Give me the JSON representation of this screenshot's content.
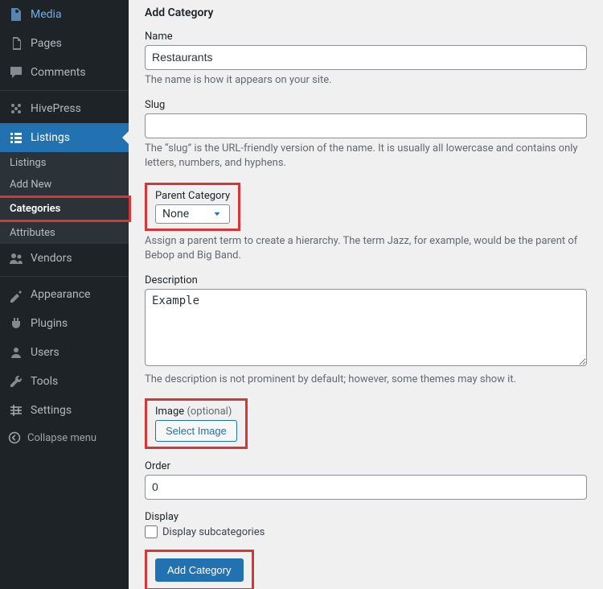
{
  "sidebar": {
    "items": [
      {
        "label": "Media"
      },
      {
        "label": "Pages"
      },
      {
        "label": "Comments"
      },
      {
        "label": "HivePress"
      },
      {
        "label": "Listings"
      },
      {
        "label": "Vendors"
      },
      {
        "label": "Appearance"
      },
      {
        "label": "Plugins"
      },
      {
        "label": "Users"
      },
      {
        "label": "Tools"
      },
      {
        "label": "Settings"
      }
    ],
    "submenu": {
      "items": [
        {
          "label": "Listings"
        },
        {
          "label": "Add New"
        },
        {
          "label": "Categories",
          "current": true
        },
        {
          "label": "Attributes"
        }
      ]
    },
    "collapse": "Collapse menu"
  },
  "main": {
    "title": "Add Category",
    "name": {
      "label": "Name",
      "value": "Restaurants",
      "help": "The name is how it appears on your site."
    },
    "slug": {
      "label": "Slug",
      "value": "",
      "help": "The “slug” is the URL-friendly version of the name. It is usually all lowercase and contains only letters, numbers, and hyphens."
    },
    "parent": {
      "label": "Parent Category",
      "value": "None",
      "help": "Assign a parent term to create a hierarchy. The term Jazz, for example, would be the parent of Bebop and Big Band."
    },
    "description": {
      "label": "Description",
      "value": "Example",
      "help": "The description is not prominent by default; however, some themes may show it."
    },
    "image": {
      "label": "Image",
      "optional": "(optional)",
      "button": "Select Image"
    },
    "order": {
      "label": "Order",
      "value": "0"
    },
    "display": {
      "label": "Display",
      "checkbox_label": "Display subcategories",
      "checked": false
    },
    "submit": "Add Category"
  }
}
